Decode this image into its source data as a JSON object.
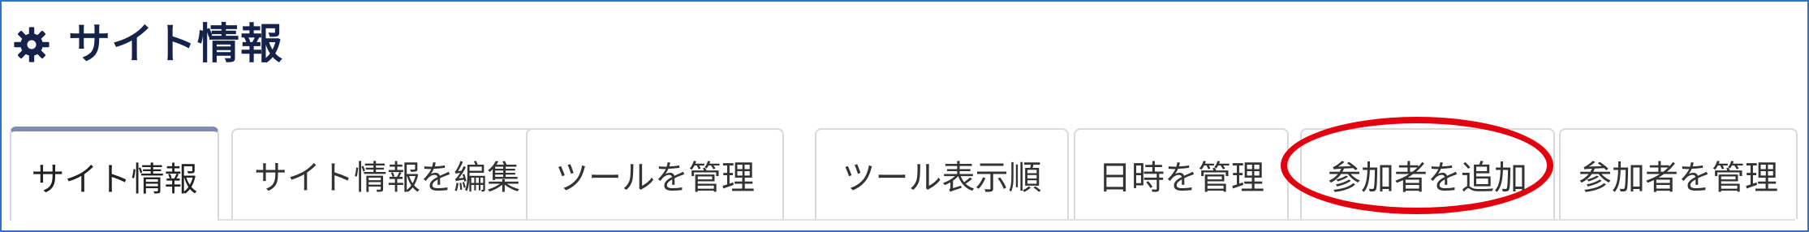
{
  "header": {
    "title": "サイト情報",
    "icon": "gear-icon",
    "title_color": "#15234b"
  },
  "tabs": [
    {
      "label": "サイト情報",
      "active": true
    },
    {
      "label": "サイト情報を編集"
    },
    {
      "label": "ツールを管理"
    },
    {
      "label": "ツール表示順"
    },
    {
      "label": "日時を管理"
    },
    {
      "label": "参加者を追加"
    },
    {
      "label": "参加者を管理"
    }
  ],
  "annotation": {
    "shape": "ellipse",
    "color": "#e3000f",
    "target": "参加者を追加"
  },
  "colors": {
    "frame_border": "#2f74c4",
    "active_tab_top": "#7f8cad",
    "tab_border": "#d9d9d9"
  }
}
